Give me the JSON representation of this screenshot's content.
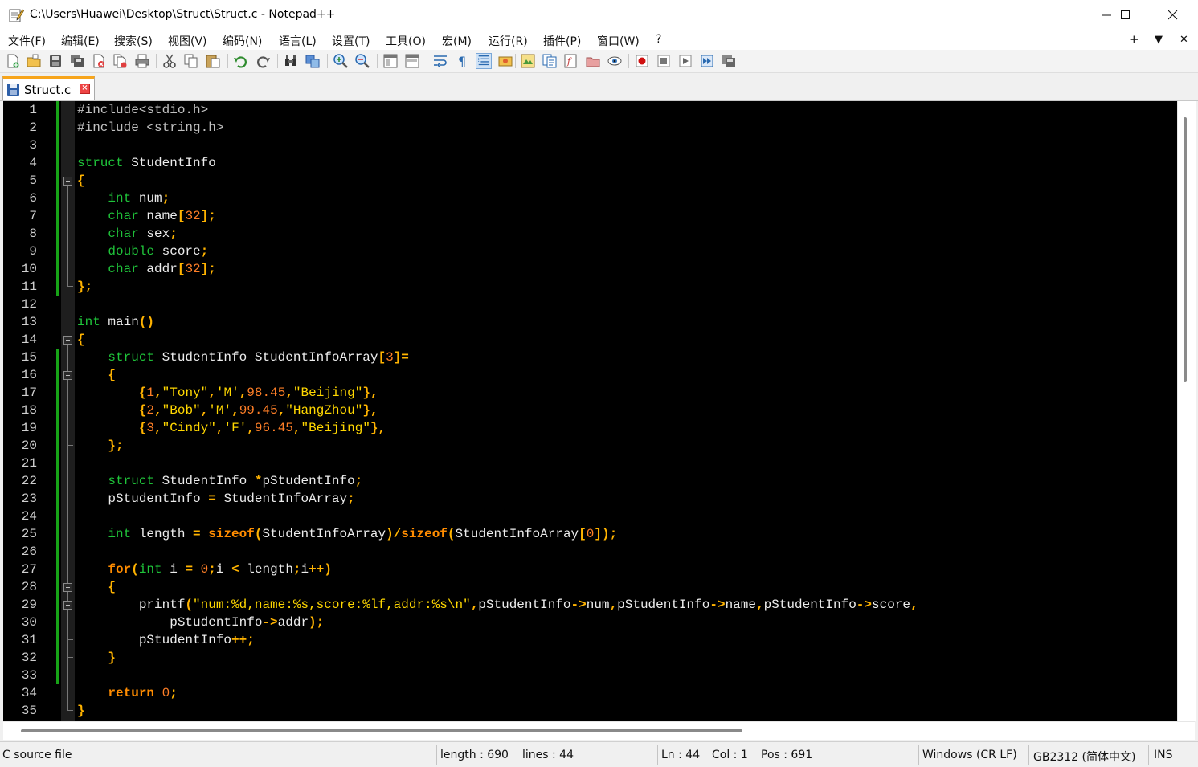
{
  "window": {
    "title": "C:\\Users\\Huawei\\Desktop\\Struct\\Struct.c - Notepad++",
    "minimize_glyph": "—",
    "maximize_glyph": "☐",
    "close_glyph": "✕"
  },
  "menu": {
    "items": [
      "文件(F)",
      "编辑(E)",
      "搜索(S)",
      "视图(V)",
      "编码(N)",
      "语言(L)",
      "设置(T)",
      "工具(O)",
      "宏(M)",
      "运行(R)",
      "插件(P)",
      "窗口(W)",
      "?"
    ],
    "right": [
      "+",
      "▼",
      "✕"
    ]
  },
  "toolbar": {
    "buttons": [
      "new-file",
      "open-file",
      "save",
      "save-all",
      "close",
      "close-all",
      "print",
      "cut",
      "copy",
      "paste",
      "undo",
      "redo",
      "find",
      "replace",
      "zoom-in",
      "zoom-out",
      "sync-vertical",
      "sync-horizontal",
      "word-wrap",
      "show-all-chars",
      "indent-guide",
      "udl",
      "document-map",
      "doc-list",
      "function-list",
      "folder-as-workspace",
      "monitoring",
      "record-macro",
      "stop-record",
      "play-macro",
      "run-macro-multiple",
      "save-macro"
    ]
  },
  "tab": {
    "label": "Struct.c",
    "close_glyph": "×"
  },
  "editor": {
    "line_numbers": [
      "1",
      "2",
      "3",
      "4",
      "5",
      "6",
      "7",
      "8",
      "9",
      "10",
      "11",
      "12",
      "13",
      "14",
      "15",
      "16",
      "17",
      "18",
      "19",
      "20",
      "21",
      "22",
      "23",
      "24",
      "25",
      "26",
      "27",
      "28",
      "29",
      "30",
      "31",
      "32",
      "33",
      "34",
      "35"
    ],
    "lines": [
      [
        [
          "pp",
          "#include<stdio.h>"
        ]
      ],
      [
        [
          "pp",
          "#include <string.h>"
        ]
      ],
      [],
      [
        [
          "k",
          "struct"
        ],
        [
          "id",
          " StudentInfo"
        ]
      ],
      [
        [
          "op",
          "{"
        ]
      ],
      [
        [
          "id",
          "    "
        ],
        [
          "k",
          "int"
        ],
        [
          "id",
          " num"
        ],
        [
          "op",
          ";"
        ]
      ],
      [
        [
          "id",
          "    "
        ],
        [
          "k",
          "char"
        ],
        [
          "id",
          " name"
        ],
        [
          "op",
          "["
        ],
        [
          "n",
          "32"
        ],
        [
          "op",
          "];"
        ]
      ],
      [
        [
          "id",
          "    "
        ],
        [
          "k",
          "char"
        ],
        [
          "id",
          " sex"
        ],
        [
          "op",
          ";"
        ]
      ],
      [
        [
          "id",
          "    "
        ],
        [
          "k",
          "double"
        ],
        [
          "id",
          " score"
        ],
        [
          "op",
          ";"
        ]
      ],
      [
        [
          "id",
          "    "
        ],
        [
          "k",
          "char"
        ],
        [
          "id",
          " addr"
        ],
        [
          "op",
          "["
        ],
        [
          "n",
          "32"
        ],
        [
          "op",
          "];"
        ]
      ],
      [
        [
          "op",
          "};"
        ]
      ],
      [],
      [
        [
          "k",
          "int"
        ],
        [
          "id",
          " main"
        ],
        [
          "op",
          "()"
        ]
      ],
      [
        [
          "op",
          "{"
        ]
      ],
      [
        [
          "id",
          "    "
        ],
        [
          "k",
          "struct"
        ],
        [
          "id",
          " StudentInfo StudentInfoArray"
        ],
        [
          "op",
          "["
        ],
        [
          "n",
          "3"
        ],
        [
          "op",
          "]="
        ]
      ],
      [
        [
          "id",
          "    "
        ],
        [
          "op",
          "{"
        ]
      ],
      [
        [
          "id",
          "        "
        ],
        [
          "op",
          "{"
        ],
        [
          "n",
          "1"
        ],
        [
          "op",
          ","
        ],
        [
          "s",
          "\"Tony\""
        ],
        [
          "op",
          ","
        ],
        [
          "s",
          "'M'"
        ],
        [
          "op",
          ","
        ],
        [
          "n",
          "98.45"
        ],
        [
          "op",
          ","
        ],
        [
          "s",
          "\"Beijing\""
        ],
        [
          "op",
          "},"
        ]
      ],
      [
        [
          "id",
          "        "
        ],
        [
          "op",
          "{"
        ],
        [
          "n",
          "2"
        ],
        [
          "op",
          ","
        ],
        [
          "s",
          "\"Bob\""
        ],
        [
          "op",
          ","
        ],
        [
          "s",
          "'M'"
        ],
        [
          "op",
          ","
        ],
        [
          "n",
          "99.45"
        ],
        [
          "op",
          ","
        ],
        [
          "s",
          "\"HangZhou\""
        ],
        [
          "op",
          "},"
        ]
      ],
      [
        [
          "id",
          "        "
        ],
        [
          "op",
          "{"
        ],
        [
          "n",
          "3"
        ],
        [
          "op",
          ","
        ],
        [
          "s",
          "\"Cindy\""
        ],
        [
          "op",
          ","
        ],
        [
          "s",
          "'F'"
        ],
        [
          "op",
          ","
        ],
        [
          "n",
          "96.45"
        ],
        [
          "op",
          ","
        ],
        [
          "s",
          "\"Beijing\""
        ],
        [
          "op",
          "},"
        ]
      ],
      [
        [
          "id",
          "    "
        ],
        [
          "op",
          "};"
        ]
      ],
      [],
      [
        [
          "id",
          "    "
        ],
        [
          "k",
          "struct"
        ],
        [
          "id",
          " StudentInfo "
        ],
        [
          "op",
          "*"
        ],
        [
          "id",
          "pStudentInfo"
        ],
        [
          "op",
          ";"
        ]
      ],
      [
        [
          "id",
          "    pStudentInfo "
        ],
        [
          "op",
          "="
        ],
        [
          "id",
          " StudentInfoArray"
        ],
        [
          "op",
          ";"
        ]
      ],
      [],
      [
        [
          "id",
          "    "
        ],
        [
          "k",
          "int"
        ],
        [
          "id",
          " length "
        ],
        [
          "op",
          "="
        ],
        [
          "id",
          " "
        ],
        [
          "kb",
          "sizeof"
        ],
        [
          "op",
          "("
        ],
        [
          "id",
          "StudentInfoArray"
        ],
        [
          "op",
          ")/"
        ],
        [
          "kb",
          "sizeof"
        ],
        [
          "op",
          "("
        ],
        [
          "id",
          "StudentInfoArray"
        ],
        [
          "op",
          "["
        ],
        [
          "n",
          "0"
        ],
        [
          "op",
          "]);"
        ]
      ],
      [],
      [
        [
          "id",
          "    "
        ],
        [
          "kb",
          "for"
        ],
        [
          "op",
          "("
        ],
        [
          "k",
          "int"
        ],
        [
          "id",
          " i "
        ],
        [
          "op",
          "="
        ],
        [
          "id",
          " "
        ],
        [
          "n",
          "0"
        ],
        [
          "op",
          ";"
        ],
        [
          "id",
          "i "
        ],
        [
          "op",
          "<"
        ],
        [
          "id",
          " length"
        ],
        [
          "op",
          ";"
        ],
        [
          "id",
          "i"
        ],
        [
          "op",
          "++)"
        ]
      ],
      [
        [
          "id",
          "    "
        ],
        [
          "op",
          "{"
        ]
      ],
      [
        [
          "id",
          "        printf"
        ],
        [
          "op",
          "("
        ],
        [
          "s",
          "\"num:%d,name:%s,score:%lf,addr:%s\\n\""
        ],
        [
          "op",
          ","
        ],
        [
          "id",
          "pStudentInfo"
        ],
        [
          "op",
          "->"
        ],
        [
          "id",
          "num"
        ],
        [
          "op",
          ","
        ],
        [
          "id",
          "pStudentInfo"
        ],
        [
          "op",
          "->"
        ],
        [
          "id",
          "name"
        ],
        [
          "op",
          ","
        ],
        [
          "id",
          "pStudentInfo"
        ],
        [
          "op",
          "->"
        ],
        [
          "id",
          "score"
        ],
        [
          "op",
          ","
        ]
      ],
      [
        [
          "id",
          "            pStudentInfo"
        ],
        [
          "op",
          "->"
        ],
        [
          "id",
          "addr"
        ],
        [
          "op",
          ");"
        ]
      ],
      [
        [
          "id",
          "        pStudentInfo"
        ],
        [
          "op",
          "++;"
        ]
      ],
      [
        [
          "id",
          "    "
        ],
        [
          "op",
          "}"
        ]
      ],
      [],
      [
        [
          "id",
          "    "
        ],
        [
          "kb",
          "return"
        ],
        [
          "id",
          " "
        ],
        [
          "n",
          "0"
        ],
        [
          "op",
          ";"
        ]
      ],
      [
        [
          "op",
          "}"
        ]
      ]
    ]
  },
  "status": {
    "file_type": "C source file",
    "length": "length : 690",
    "lines": "lines : 44",
    "ln": "Ln : 44",
    "col": "Col : 1",
    "pos": "Pos : 691",
    "eol": "Windows (CR LF)",
    "encoding": "GB2312 (简体中文)",
    "mode": "INS"
  },
  "colors": {
    "keyword": "#1fc43a",
    "keyword_bold": "#ff8c00",
    "string": "#ffd700",
    "number": "#ff7f27",
    "operator": "#ffb300",
    "change_bar": "#17a317",
    "tab_accent": "#f7a51c"
  }
}
